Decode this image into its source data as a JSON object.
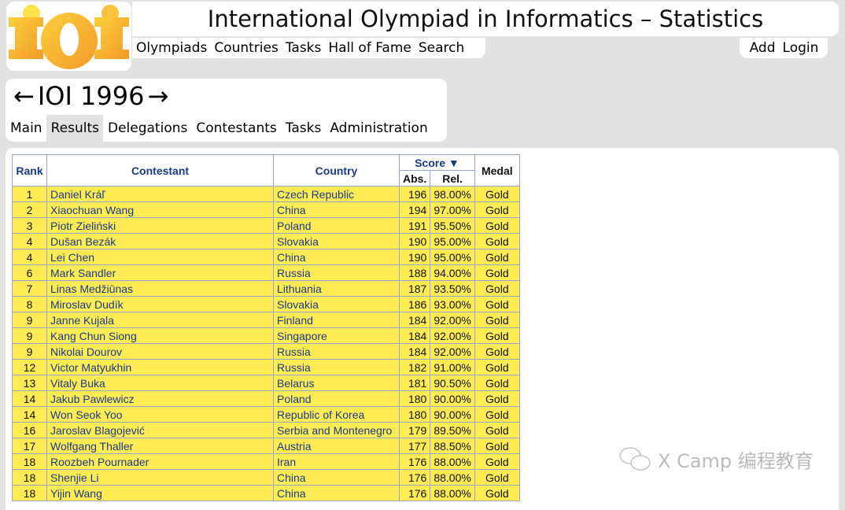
{
  "logo_text": "ioi",
  "site_title": "International Olympiad in Informatics – Statistics",
  "nav": [
    "Olympiads",
    "Countries",
    "Tasks",
    "Hall of Fame",
    "Search"
  ],
  "right_nav": [
    "Add",
    "Login"
  ],
  "olympiad": {
    "prev": "←",
    "title": "IOI 1996",
    "next": "→"
  },
  "tabs": [
    "Main",
    "Results",
    "Delegations",
    "Contestants",
    "Tasks",
    "Administration"
  ],
  "active_tab": "Results",
  "table": {
    "headers": {
      "rank": "Rank",
      "contestant": "Contestant",
      "country": "Country",
      "score": "Score ▼",
      "abs": "Abs.",
      "rel": "Rel.",
      "medal": "Medal"
    },
    "rows": [
      [
        "1",
        "Daniel Kráľ",
        "Czech Republic",
        "196",
        "98.00%",
        "Gold"
      ],
      [
        "2",
        "Xiaochuan Wang",
        "China",
        "194",
        "97.00%",
        "Gold"
      ],
      [
        "3",
        "Piotr Zieliński",
        "Poland",
        "191",
        "95.50%",
        "Gold"
      ],
      [
        "4",
        "Dušan Bezák",
        "Slovakia",
        "190",
        "95.00%",
        "Gold"
      ],
      [
        "4",
        "Lei Chen",
        "China",
        "190",
        "95.00%",
        "Gold"
      ],
      [
        "6",
        "Mark Sandler",
        "Russia",
        "188",
        "94.00%",
        "Gold"
      ],
      [
        "7",
        "Linas Medžiūnas",
        "Lithuania",
        "187",
        "93.50%",
        "Gold"
      ],
      [
        "8",
        "Miroslav Dudík",
        "Slovakia",
        "186",
        "93.00%",
        "Gold"
      ],
      [
        "9",
        "Janne Kujala",
        "Finland",
        "184",
        "92.00%",
        "Gold"
      ],
      [
        "9",
        "Kang Chun Siong",
        "Singapore",
        "184",
        "92.00%",
        "Gold"
      ],
      [
        "9",
        "Nikolai Dourov",
        "Russia",
        "184",
        "92.00%",
        "Gold"
      ],
      [
        "12",
        "Victor Matyukhin",
        "Russia",
        "182",
        "91.00%",
        "Gold"
      ],
      [
        "13",
        "Vitaly Buka",
        "Belarus",
        "181",
        "90.50%",
        "Gold"
      ],
      [
        "14",
        "Jakub Pawlewicz",
        "Poland",
        "180",
        "90.00%",
        "Gold"
      ],
      [
        "14",
        "Won Seok Yoo",
        "Republic of Korea",
        "180",
        "90.00%",
        "Gold"
      ],
      [
        "16",
        "Jaroslav Blagojević",
        "Serbia and Montenegro",
        "179",
        "89.50%",
        "Gold"
      ],
      [
        "17",
        "Wolfgang Thaller",
        "Austria",
        "177",
        "88.50%",
        "Gold"
      ],
      [
        "18",
        "Roozbeh Pournader",
        "Iran",
        "176",
        "88.00%",
        "Gold"
      ],
      [
        "18",
        "Shenjie Li",
        "China",
        "176",
        "88.00%",
        "Gold"
      ],
      [
        "18",
        "Yijin Wang",
        "China",
        "176",
        "88.00%",
        "Gold"
      ]
    ]
  },
  "watermark": "X Camp 编程教育",
  "colors": {
    "gold_row": "#ffec55",
    "link": "#1a3a86",
    "background": "#e2e2e2"
  }
}
